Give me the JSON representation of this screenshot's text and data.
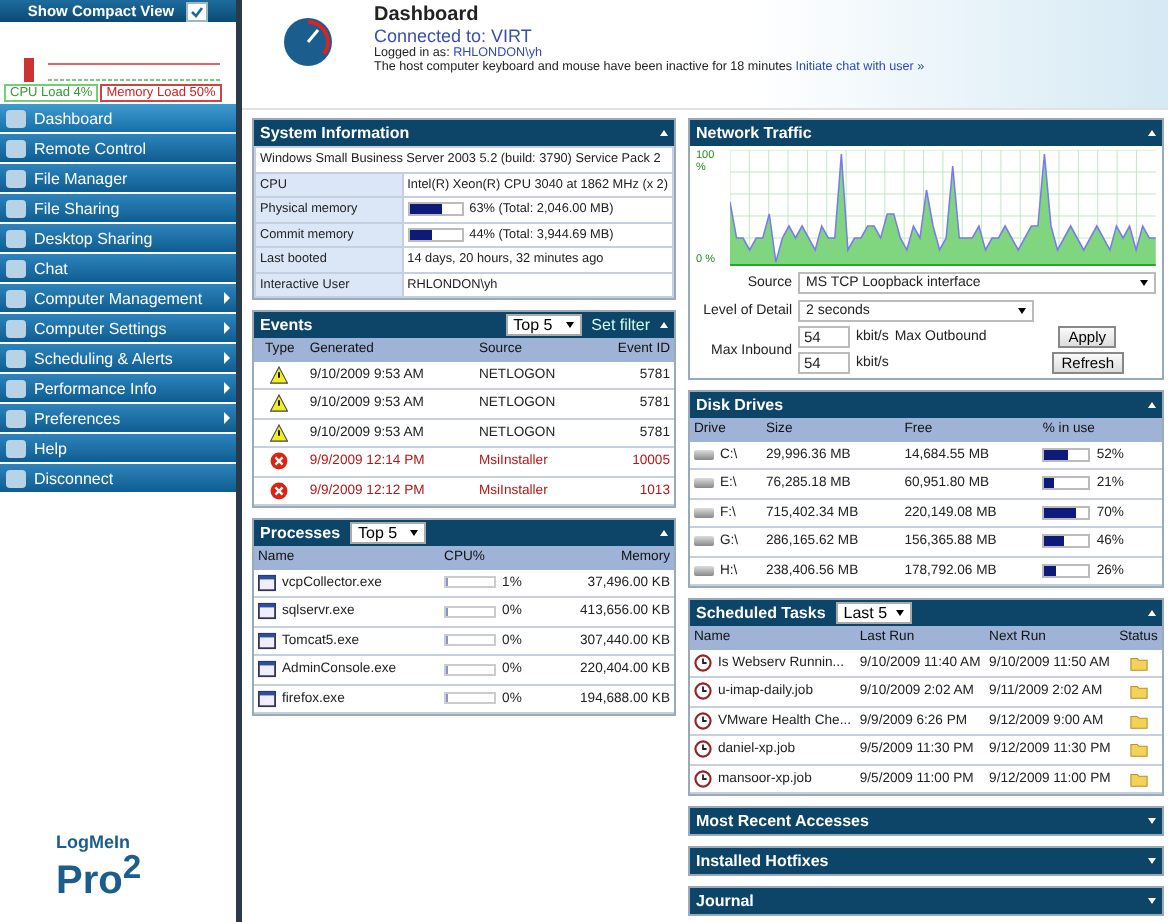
{
  "sidebar": {
    "compact_view": {
      "label": "Show Compact View",
      "checked": true
    },
    "cpu_load": "CPU Load 4%",
    "memory_load": "Memory Load 50%",
    "items": [
      {
        "label": "Dashboard",
        "selected": true,
        "submenu": false
      },
      {
        "label": "Remote Control",
        "selected": false,
        "submenu": false
      },
      {
        "label": "File Manager",
        "selected": false,
        "submenu": false
      },
      {
        "label": "File Sharing",
        "selected": false,
        "submenu": false
      },
      {
        "label": "Desktop Sharing",
        "selected": false,
        "submenu": false
      },
      {
        "label": "Chat",
        "selected": false,
        "submenu": false
      },
      {
        "label": "Computer Management",
        "selected": false,
        "submenu": true
      },
      {
        "label": "Computer Settings",
        "selected": false,
        "submenu": true
      },
      {
        "label": "Scheduling & Alerts",
        "selected": false,
        "submenu": true
      },
      {
        "label": "Performance Info",
        "selected": false,
        "submenu": true
      },
      {
        "label": "Preferences",
        "selected": false,
        "submenu": true
      },
      {
        "label": "Help",
        "selected": false,
        "submenu": false
      },
      {
        "label": "Disconnect",
        "selected": false,
        "submenu": false
      }
    ],
    "logo": {
      "name": "LogMeIn",
      "product": "Pro$^{2}$"
    }
  },
  "header": {
    "title": "Dashboard",
    "connected": "Connected to: VIRT",
    "logged_label": "Logged in as:",
    "user": "RHLONDON\\yh",
    "inactive": "The host computer keyboard and mouse have been inactive for  18 minutes",
    "chat_link": "Initiate chat with user  »"
  },
  "system_information": {
    "title": "System Information",
    "expanded": true,
    "os": "Windows Small Business Server 2003 5.2 (build: 3790) Service Pack 2",
    "rows": [
      {
        "kind": "text",
        "label": "CPU",
        "value": "Intel(R) Xeon(R) CPU 3040 at 1862 MHz (x 2)"
      },
      {
        "kind": "meter",
        "label": "Physical memory",
        "level": 0.63,
        "value": "63% (Total: 2,046.00 MB)"
      },
      {
        "kind": "meter",
        "label": "Commit memory",
        "level": 0.44,
        "value": "44% (Total: 3,944.69 MB)"
      },
      {
        "kind": "text",
        "label": "Last booted",
        "value": "14 days, 20 hours, 32 minutes ago"
      },
      {
        "kind": "text",
        "label": "Interactive User",
        "value": "RHLONDON\\yh"
      }
    ]
  },
  "events": {
    "title": "Events",
    "expanded": true,
    "filter": "Top 5",
    "set_filter": "Set filter",
    "columns": [
      "Type",
      "Generated",
      "Source",
      "Event ID"
    ],
    "rows": [
      {
        "kind": "warning",
        "generated": "9/10/2009 9:53 AM",
        "source": "NETLOGON",
        "event_id": "5781"
      },
      {
        "kind": "warning",
        "generated": "9/10/2009 9:53 AM",
        "source": "NETLOGON",
        "event_id": "5781"
      },
      {
        "kind": "warning",
        "generated": "9/10/2009 9:53 AM",
        "source": "NETLOGON",
        "event_id": "5781"
      },
      {
        "kind": "error",
        "generated": "9/9/2009 12:14 PM",
        "source": "MsiInstaller",
        "event_id": "10005"
      },
      {
        "kind": "error",
        "generated": "9/9/2009 12:12 PM",
        "source": "MsiInstaller",
        "event_id": "1013"
      }
    ]
  },
  "processes": {
    "title": "Processes",
    "expanded": true,
    "filter": "Top 5",
    "columns": [
      "Name",
      "CPU%",
      "Memory"
    ],
    "rows": [
      {
        "name": "vcpCollector.exe",
        "level": 0.01,
        "cpu": "1%",
        "memory": "37,496.00 KB"
      },
      {
        "name": "sqlservr.exe",
        "level": 0,
        "cpu": "0%",
        "memory": "413,656.00 KB"
      },
      {
        "name": "Tomcat5.exe",
        "level": 0,
        "cpu": "0%",
        "memory": "307,440.00 KB"
      },
      {
        "name": "AdminConsole.exe",
        "level": 0,
        "cpu": "0%",
        "memory": "220,404.00 KB"
      },
      {
        "name": "firefox.exe",
        "level": 0,
        "cpu": "0%",
        "memory": "194,688.00 KB"
      }
    ]
  },
  "network_traffic": {
    "title": "Network Traffic",
    "expanded": true,
    "top_label": "100 %",
    "bottom_label": "0 %",
    "source_label": "Source",
    "source": "MS TCP Loopback interface",
    "detail_label": "Level of Detail",
    "detail": "2 seconds",
    "max_inbound_label": "Max Inbound",
    "max_inbound": "54",
    "unit_in": "kbit/s",
    "max_outbound_label": "Max Outbound",
    "max_outbound": "54",
    "unit_out": "kbit/s",
    "buttons": [
      "Apply",
      "Refresh"
    ]
  },
  "disk_drives": {
    "title": "Disk Drives",
    "expanded": true,
    "columns": [
      "Drive",
      "Size",
      "Free",
      "% in use"
    ],
    "rows": [
      {
        "drive": "C:\\",
        "size": "29,996.36 MB",
        "free": "14,684.55 MB",
        "level": 0.52,
        "use": "52%"
      },
      {
        "drive": "E:\\",
        "size": "76,285.18 MB",
        "free": "60,951.80 MB",
        "level": 0.21,
        "use": "21%"
      },
      {
        "drive": "F:\\",
        "size": "715,402.34 MB",
        "free": "220,149.08 MB",
        "level": 0.7,
        "use": "70%"
      },
      {
        "drive": "G:\\",
        "size": "286,165.62 MB",
        "free": "156,365.88 MB",
        "level": 0.46,
        "use": "46%"
      },
      {
        "drive": "H:\\",
        "size": "238,406.56 MB",
        "free": "178,792.06 MB",
        "level": 0.26,
        "use": "26%"
      }
    ]
  },
  "scheduled_tasks": {
    "title": "Scheduled Tasks",
    "expanded": true,
    "filter": "Last 5",
    "columns": [
      "Name",
      "Last Run",
      "Next Run",
      "Status"
    ],
    "rows": [
      {
        "name": "Is Webserv Runnin...",
        "last_run": "9/10/2009 11:40 AM",
        "next_run": "9/10/2009 11:50 AM"
      },
      {
        "name": "u-imap-daily.job",
        "last_run": "9/10/2009 2:02 AM",
        "next_run": "9/11/2009 2:02 AM"
      },
      {
        "name": "VMware Health Che...",
        "last_run": "9/9/2009 6:26 PM",
        "next_run": "9/12/2009 9:00 AM"
      },
      {
        "name": "daniel-xp.job",
        "last_run": "9/5/2009 11:30 PM",
        "next_run": "9/12/2009 11:30 PM"
      },
      {
        "name": "mansoor-xp.job",
        "last_run": "9/5/2009 11:00 PM",
        "next_run": "9/12/2009 11:00 PM"
      }
    ]
  },
  "collapsed_panels": [
    {
      "title": "Most Recent Accesses",
      "expanded": false
    },
    {
      "title": "Installed Hotfixes",
      "expanded": false
    },
    {
      "title": "Journal",
      "expanded": false
    }
  ]
}
